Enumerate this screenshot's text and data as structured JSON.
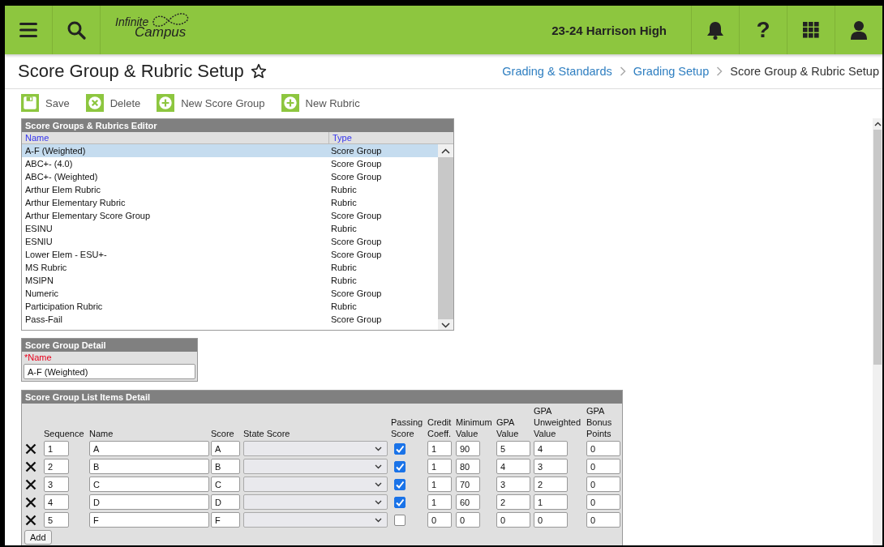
{
  "header": {
    "logo_top": "Infinite",
    "logo_bottom": "Campus",
    "school": "23-24 Harrison High",
    "help": "?"
  },
  "page": {
    "title": "Score Group & Rubric Setup",
    "favorite": false,
    "breadcrumbs": [
      {
        "label": "Grading & Standards",
        "current": false
      },
      {
        "label": "Grading Setup",
        "current": false
      },
      {
        "label": "Score Group & Rubric Setup",
        "current": true
      }
    ]
  },
  "toolbar": [
    {
      "kind": "save",
      "label": "Save"
    },
    {
      "kind": "delete",
      "label": "Delete"
    },
    {
      "kind": "add",
      "label": "New Score Group"
    },
    {
      "kind": "add",
      "label": "New Rubric"
    }
  ],
  "editor": {
    "title": "Score Groups & Rubrics Editor",
    "columns": [
      "Name",
      "Type"
    ],
    "rows": [
      {
        "name": "A-F (Weighted)",
        "type": "Score Group",
        "selected": true
      },
      {
        "name": "ABC+- (4.0)",
        "type": "Score Group",
        "selected": false
      },
      {
        "name": "ABC+- (Weighted)",
        "type": "Score Group",
        "selected": false
      },
      {
        "name": "Arthur Elem Rubric",
        "type": "Rubric",
        "selected": false
      },
      {
        "name": "Arthur Elementary Rubric",
        "type": "Rubric",
        "selected": false
      },
      {
        "name": "Arthur Elementary Score Group",
        "type": "Score Group",
        "selected": false
      },
      {
        "name": "ESINU",
        "type": "Rubric",
        "selected": false
      },
      {
        "name": "ESNIU",
        "type": "Score Group",
        "selected": false
      },
      {
        "name": "Lower Elem - ESU+-",
        "type": "Score Group",
        "selected": false
      },
      {
        "name": "MS Rubric",
        "type": "Rubric",
        "selected": false
      },
      {
        "name": "MSIPN",
        "type": "Rubric",
        "selected": false
      },
      {
        "name": "Numeric",
        "type": "Score Group",
        "selected": false
      },
      {
        "name": "Participation Rubric",
        "type": "Rubric",
        "selected": false
      },
      {
        "name": "Pass-Fail",
        "type": "Score Group",
        "selected": false
      }
    ]
  },
  "detail": {
    "title": "Score Group Detail",
    "label": "*Name",
    "value": "A-F (Weighted)"
  },
  "items": {
    "title": "Score Group List Items Detail",
    "columns": [
      "Sequence",
      "Name",
      "Score",
      "State Score",
      "Passing Score",
      "Credit Coeff.",
      "Minimum Value",
      "GPA Value",
      "GPA Unweighted Value",
      "GPA Bonus Points"
    ],
    "rows": [
      {
        "sequence": "1",
        "name": "A",
        "score": "A",
        "passing": true,
        "credit": "1",
        "minimum": "90",
        "gpa": "5",
        "unweighted": "4",
        "bonus": "0"
      },
      {
        "sequence": "2",
        "name": "B",
        "score": "B",
        "passing": true,
        "credit": "1",
        "minimum": "80",
        "gpa": "4",
        "unweighted": "3",
        "bonus": "0"
      },
      {
        "sequence": "3",
        "name": "C",
        "score": "C",
        "passing": true,
        "credit": "1",
        "minimum": "70",
        "gpa": "3",
        "unweighted": "2",
        "bonus": "0"
      },
      {
        "sequence": "4",
        "name": "D",
        "score": "D",
        "passing": true,
        "credit": "1",
        "minimum": "60",
        "gpa": "2",
        "unweighted": "1",
        "bonus": "0"
      },
      {
        "sequence": "5",
        "name": "F",
        "score": "F",
        "passing": false,
        "credit": "0",
        "minimum": "0",
        "gpa": "0",
        "unweighted": "0",
        "bonus": "0"
      }
    ],
    "add_label": "Add"
  }
}
